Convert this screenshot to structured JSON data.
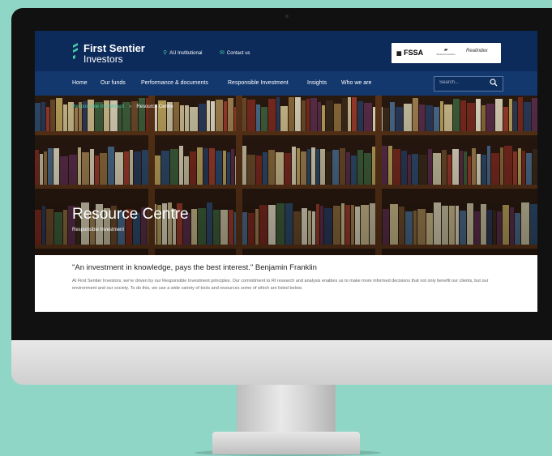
{
  "header": {
    "logo_line1": "First Sentier",
    "logo_line2": "Investors",
    "au_institutional": "AU Institutional",
    "contact_us": "Contact us",
    "partners": {
      "fssa": "FSSA",
      "stewart": "Stewart Investors",
      "realindex": "Realindex"
    }
  },
  "nav": {
    "items": [
      "Home",
      "Our funds",
      "Performance & documents",
      "Responsible Investment",
      "Insights",
      "Who we are"
    ],
    "search_placeholder": "Search..."
  },
  "hero": {
    "breadcrumb": [
      "Responsible Investment",
      "Resource Centre"
    ],
    "breadcrumb_sep": "›",
    "title": "Resource Centre",
    "subtitle": "Responsible Investment"
  },
  "content": {
    "quote": "\"An investment in knowledge, pays the best interest.\" Benjamin Franklin",
    "intro": "At First Sentier Investors, we're driven by our Responsible Investment principles. Our commitment to RI research and analysis enables us to make more informed decisions that not only benefit our clients, but our environment and our society.  To do this, we use a wide variety of tools and resources some of which are listed below."
  },
  "colors": {
    "header_bg": "#0c2a5a",
    "nav_bg": "#13386e",
    "accent": "#47c9a8",
    "background": "#8fd6c6"
  }
}
